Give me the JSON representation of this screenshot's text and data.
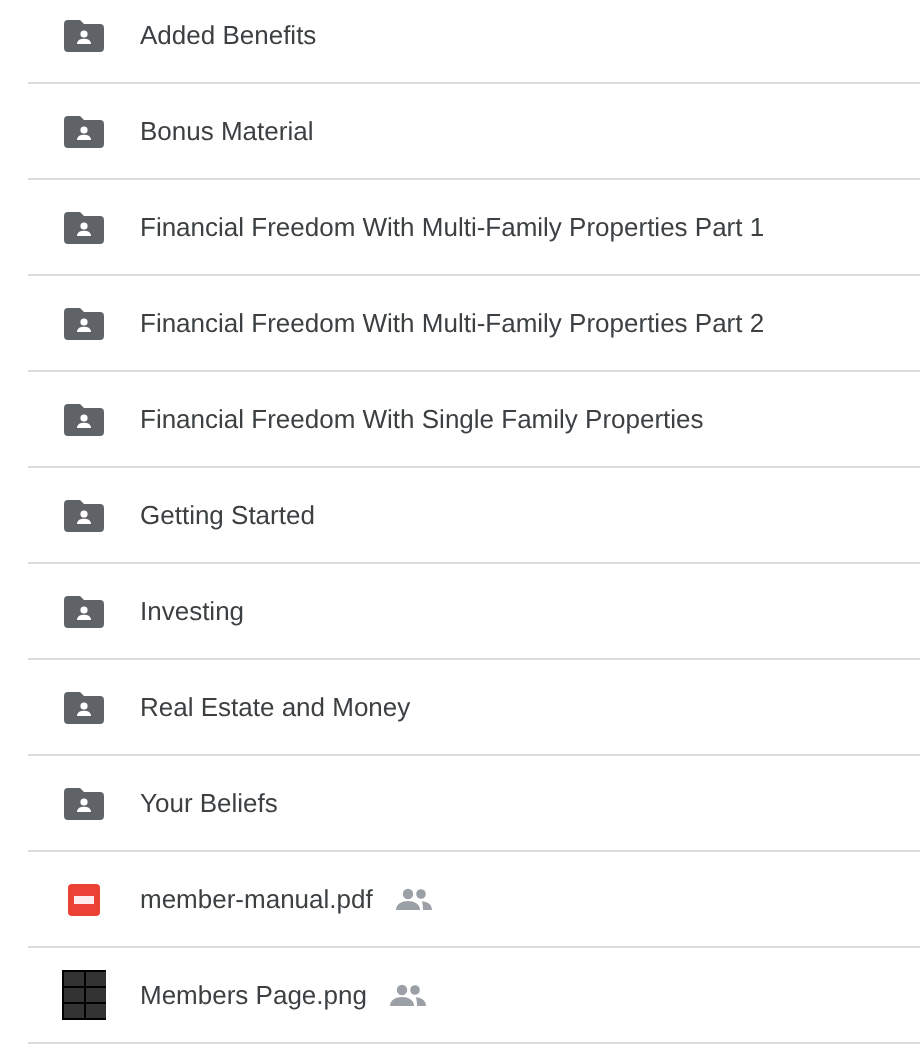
{
  "files": [
    {
      "name": "Added Benefits",
      "kind": "folder",
      "shared": false
    },
    {
      "name": "Bonus Material",
      "kind": "folder",
      "shared": false
    },
    {
      "name": "Financial Freedom With Multi-Family Properties Part 1",
      "kind": "folder",
      "shared": false
    },
    {
      "name": "Financial Freedom With Multi-Family Properties Part 2",
      "kind": "folder",
      "shared": false
    },
    {
      "name": "Financial Freedom With Single Family Properties",
      "kind": "folder",
      "shared": false
    },
    {
      "name": "Getting Started",
      "kind": "folder",
      "shared": false
    },
    {
      "name": "Investing",
      "kind": "folder",
      "shared": false
    },
    {
      "name": "Real Estate and Money",
      "kind": "folder",
      "shared": false
    },
    {
      "name": "Your Beliefs",
      "kind": "folder",
      "shared": false
    },
    {
      "name": "member-manual.pdf",
      "kind": "pdf",
      "shared": true
    },
    {
      "name": "Members Page.png",
      "kind": "image",
      "shared": true
    }
  ]
}
